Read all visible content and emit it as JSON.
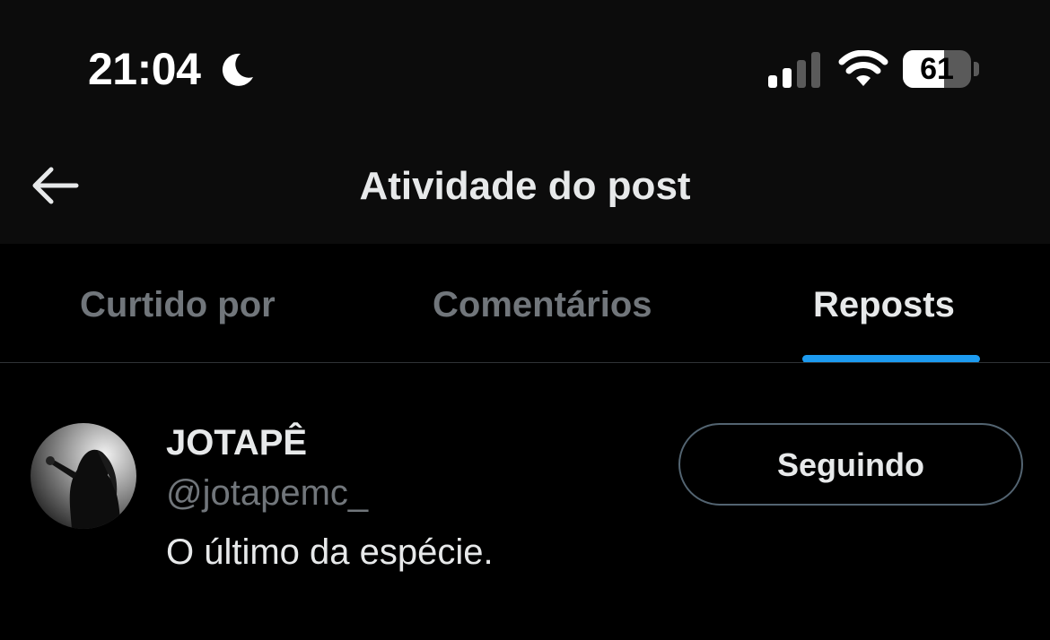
{
  "status_bar": {
    "time": "21:04",
    "battery_level": "61",
    "battery_percent": 61,
    "icons": [
      "moon-icon",
      "cellular-signal-icon",
      "wifi-icon",
      "battery-icon"
    ]
  },
  "header": {
    "title": "Atividade do post",
    "back_icon": "arrow-left-icon"
  },
  "tabs": [
    {
      "label": "Curtido por",
      "active": false
    },
    {
      "label": "Comentários",
      "active": false
    },
    {
      "label": "Reposts",
      "active": true
    }
  ],
  "users": [
    {
      "name": "JOTAPÊ",
      "handle": "@jotapemc_",
      "bio": "O último da espécie.",
      "button_label": "Seguindo"
    }
  ],
  "colors": {
    "background": "#000000",
    "header_background": "#0c0c0c",
    "accent": "#1d9bf0",
    "text_primary": "#e7e9ea",
    "text_secondary": "#71767b"
  }
}
